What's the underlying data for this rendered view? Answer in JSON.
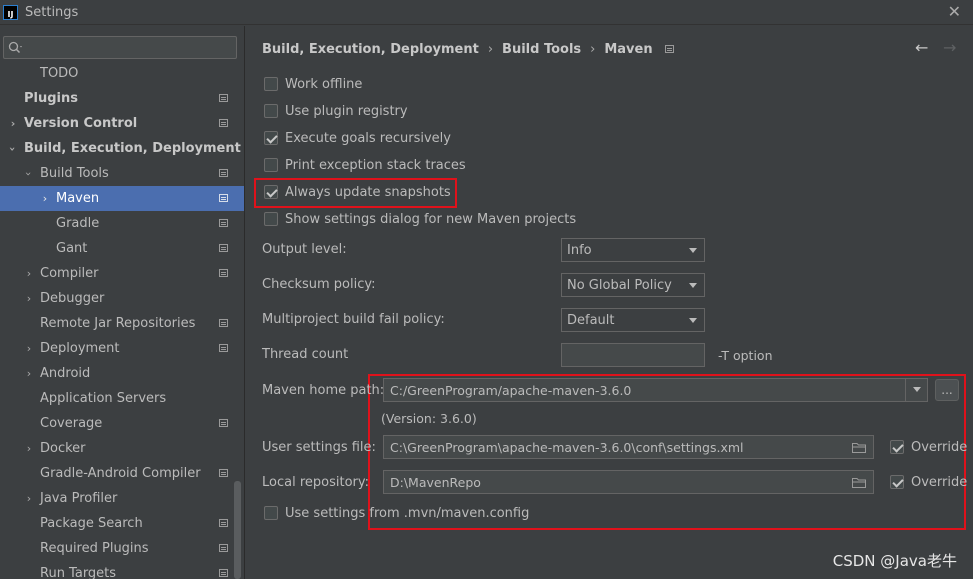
{
  "window": {
    "title": "Settings",
    "app_icon_text": "IJ"
  },
  "search": {
    "placeholder": ""
  },
  "sidebar": {
    "items": [
      {
        "label": "TODO",
        "level": 2
      },
      {
        "label": "Plugins",
        "level": 0,
        "bold": true,
        "project_icon": true
      },
      {
        "label": "Version Control",
        "level": 0,
        "bold": true,
        "arrow": "collapsed",
        "project_icon": true
      },
      {
        "label": "Build, Execution, Deployment",
        "level": 0,
        "bold": true,
        "arrow": "expanded"
      },
      {
        "label": "Build Tools",
        "level": 1,
        "arrow": "expanded",
        "project_icon": true
      },
      {
        "label": "Maven",
        "level": 2,
        "arrow": "collapsed",
        "project_icon": true,
        "selected": true
      },
      {
        "label": "Gradle",
        "level": 2,
        "project_icon": true
      },
      {
        "label": "Gant",
        "level": 2,
        "project_icon": true
      },
      {
        "label": "Compiler",
        "level": 1,
        "arrow": "collapsed",
        "project_icon": true
      },
      {
        "label": "Debugger",
        "level": 1,
        "arrow": "collapsed"
      },
      {
        "label": "Remote Jar Repositories",
        "level": 1,
        "project_icon": true
      },
      {
        "label": "Deployment",
        "level": 1,
        "arrow": "collapsed",
        "project_icon": true
      },
      {
        "label": "Android",
        "level": 1,
        "arrow": "collapsed"
      },
      {
        "label": "Application Servers",
        "level": 1
      },
      {
        "label": "Coverage",
        "level": 1,
        "project_icon": true
      },
      {
        "label": "Docker",
        "level": 1,
        "arrow": "collapsed"
      },
      {
        "label": "Gradle-Android Compiler",
        "level": 1,
        "project_icon": true
      },
      {
        "label": "Java Profiler",
        "level": 1,
        "arrow": "collapsed"
      },
      {
        "label": "Package Search",
        "level": 1,
        "project_icon": true
      },
      {
        "label": "Required Plugins",
        "level": 1,
        "project_icon": true
      },
      {
        "label": "Run Targets",
        "level": 1,
        "project_icon": true
      }
    ]
  },
  "breadcrumb": {
    "parts": [
      "Build, Execution, Deployment",
      "Build Tools",
      "Maven"
    ],
    "separator": "›"
  },
  "nav": {
    "back": "←",
    "forward": "→"
  },
  "checkboxes": [
    {
      "label": "Work offline",
      "checked": false
    },
    {
      "label": "Use plugin registry",
      "checked": false
    },
    {
      "label": "Execute goals recursively",
      "checked": true
    },
    {
      "label": "Print exception stack traces",
      "checked": false
    },
    {
      "label": "Always update snapshots",
      "checked": true
    },
    {
      "label": "Show settings dialog for new Maven projects",
      "checked": false
    }
  ],
  "fields": {
    "output_level": {
      "label": "Output level:",
      "value": "Info"
    },
    "checksum_policy": {
      "label": "Checksum policy:",
      "value": "No Global Policy"
    },
    "fail_policy": {
      "label": "Multiproject build fail policy:",
      "value": "Default"
    },
    "thread_count": {
      "label": "Thread count",
      "value": "",
      "hint": "-T option"
    },
    "maven_home": {
      "label": "Maven home path:",
      "value": "C:/GreenProgram/apache-maven-3.6.0",
      "version": "(Version: 3.6.0)",
      "browse": "..."
    },
    "user_settings": {
      "label": "User settings file:",
      "value": "C:\\GreenProgram\\apache-maven-3.6.0\\conf\\settings.xml",
      "override_label": "Override",
      "override": true
    },
    "local_repo": {
      "label": "Local repository:",
      "value": "D:\\MavenRepo",
      "override_label": "Override",
      "override": true
    }
  },
  "mvn_config": {
    "label": "Use settings from .mvn/maven.config",
    "checked": false
  },
  "watermark": "CSDN @Java老牛",
  "colors": {
    "selection": "#4b6eaf",
    "highlight_box": "#e0121b",
    "background": "#3c3f41"
  }
}
